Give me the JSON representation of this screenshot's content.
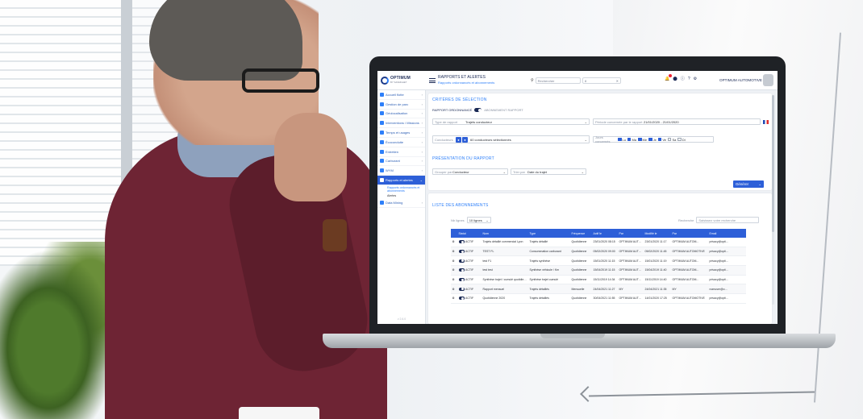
{
  "app": {
    "logo_title": "OPTIMUM",
    "logo_sub": "BY SAFEFLEET",
    "breadcrumb_title": "RAPPORTS ET ALERTES",
    "breadcrumb_sub": "Rapports ordonnancés et abonnements",
    "search_placeholder": "Rechercher",
    "search_value": "8",
    "company_name": "OPTIMUM AUTOMOTIVE"
  },
  "sidebar": {
    "items": [
      {
        "label": "Accueil flotte",
        "icon": "home-icon"
      },
      {
        "label": "Gestion de parc",
        "icon": "car-icon"
      },
      {
        "label": "Géolocalisation",
        "icon": "map-pin-icon"
      },
      {
        "label": "Interventions / Missions",
        "icon": "wrench-icon"
      },
      {
        "label": "Temps et usages",
        "icon": "clock-icon"
      },
      {
        "label": "Écoconduite",
        "icon": "leaf-icon"
      },
      {
        "label": "Entretien",
        "icon": "tools-icon"
      },
      {
        "label": "Carburant",
        "icon": "fuel-icon"
      },
      {
        "label": "WYM",
        "icon": "gauge-icon"
      },
      {
        "label": "Rapports et alertes",
        "icon": "chart-icon"
      },
      {
        "label": "Data Mining",
        "icon": "database-icon"
      }
    ],
    "subitems": [
      "Rapports ordonnancés et abonnements",
      "Alertes"
    ],
    "footer": "v 2.6.0"
  },
  "criteria": {
    "title": "CRITÈRES DE SÉLECTION",
    "toggle_on_label": "RAPPORT ORDONNANCÉ",
    "toggle_off_label": "ABONNEMENT RAPPORT",
    "type_label": "Type de rapport",
    "type_value": "Trajets conducteur",
    "period_label": "Période concernée par le rapport",
    "period_value": "21/01/2020 - 21/01/2020",
    "conductors_label": "Conducteurs",
    "conductors_value": "60 conducteurs sélectionnés",
    "days_label": "Jours concernés",
    "days": [
      "Lu",
      "Ma",
      "Me",
      "Je",
      "Ve",
      "Sa",
      "Di"
    ],
    "days_checked": [
      true,
      true,
      true,
      true,
      true,
      false,
      false
    ]
  },
  "presentation": {
    "title": "PRÉSENTATION DU RAPPORT",
    "group_label": "Grouper par",
    "group_value": "Conducteur",
    "sort_label": "Trier par",
    "sort_value": "Date du trajet",
    "submit_label": "Générer"
  },
  "subscriptions": {
    "title": "LISTE DES ABONNEMENTS",
    "page_size_label": "Nb lignes",
    "page_size_value": "10 lignes",
    "search_label": "Recherche",
    "search_placeholder": "Saisissez votre recherche",
    "columns": [
      "",
      "Statut",
      "Nom",
      "Type",
      "Fréquence",
      "Actif le",
      "Par",
      "Modifié le",
      "Par",
      "Email"
    ],
    "rows": [
      {
        "status": "ACTIF",
        "name": "Trajets détaillé commercial Lyon",
        "type": "Trajets détaillé",
        "freq": "Quotidienne",
        "active": "23/01/2020 08:15",
        "by": "OPTIMUM AUTOM...",
        "modified": "23/01/2020 11:17",
        "mod_by": "OPTIMUM AUTOM...",
        "email": "privacy@optimum..."
      },
      {
        "status": "ACTIF",
        "name": "TEST FL",
        "type": "Consommation carburant",
        "freq": "Quotidienne",
        "active": "05/02/2020 09:00",
        "by": "OPTIMUM AUTOM...",
        "modified": "05/02/2020 11:45",
        "mod_by": "OPTIMUM AUTOMOTIVE",
        "email": "privacy@optimum..."
      },
      {
        "status": "ACTIF",
        "name": "test F1",
        "type": "Trajets synthèse",
        "freq": "Quotidienne",
        "active": "15/01/2020 11:15",
        "by": "OPTIMUM AUTOM...",
        "modified": "15/01/2020 11:19",
        "mod_by": "OPTIMUM AUTOM...",
        "email": "privacy@optimum..."
      },
      {
        "status": "ACTIF",
        "name": "test test",
        "type": "Synthèse véhicule / Km",
        "freq": "Quotidienne",
        "active": "15/04/2019 11:15",
        "by": "OPTIMUM AUTOM...",
        "modified": "15/04/2019 11:40",
        "mod_by": "OPTIMUM AUTOM...",
        "email": "privacy@optimum..."
      },
      {
        "status": "ACTIF",
        "name": "Synthèse trajet / cumulé quotidienne",
        "type": "Synthèse trajet cumulé",
        "freq": "Quotidienne",
        "active": "15/11/2019 14:34",
        "by": "OPTIMUM AUTOM...",
        "modified": "15/11/2019 14:40",
        "mod_by": "OPTIMUM AUTOM...",
        "email": "privacy@optimum..."
      },
      {
        "status": "ACTIF",
        "name": "Rapport mensuel",
        "type": "Trajets détaillés",
        "freq": "Mensuelle",
        "active": "24/04/2021 11:27",
        "by": "MY",
        "modified": "24/04/2021 11:35",
        "mod_by": "MY",
        "email": "nomuser@optimum"
      },
      {
        "status": "ACTIF",
        "name": "Quotidienne 2020",
        "type": "Trajets détaillés",
        "freq": "Quotidienne",
        "active": "30/04/2021 11:55",
        "by": "OPTIMUM AUTOM...",
        "modified": "14/01/2020 17:25",
        "mod_by": "OPTIMUM AUTOMOTIVE",
        "email": "privacy@optimum.fr"
      }
    ]
  },
  "colors": {
    "primary": "#2d5fd8",
    "accent": "#2d7ff9",
    "navy": "#1b2a55"
  }
}
